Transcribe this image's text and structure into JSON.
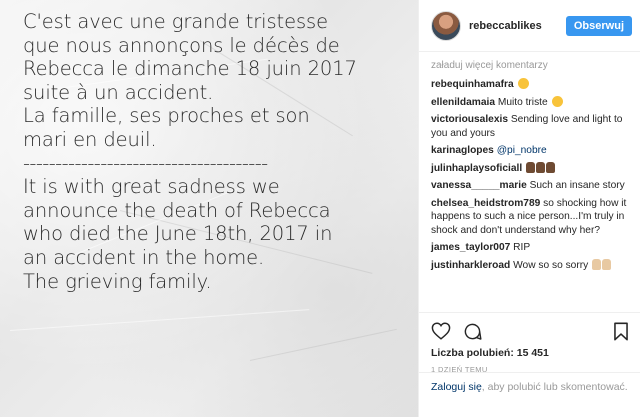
{
  "photo": {
    "lines": [
      "C'est avec une grande tristesse",
      "que nous annonçons le décès de",
      "Rebecca le dimanche 18 juin 2017",
      "suite à un accident.",
      "La famille, ses proches et son",
      "mari en deuil.",
      "--------------------------------------",
      "It is with great sadness we",
      "announce the death of Rebecca",
      "who died the June 18th, 2017 in",
      "an accident in the home.",
      "The grieving family."
    ]
  },
  "header": {
    "username": "rebeccablikes",
    "follow_label": "Obserwuj"
  },
  "comments": {
    "load_more": "załaduj więcej komentarzy",
    "items": [
      {
        "user": "rebequinhamafra",
        "text": "",
        "emoji": [
          "sad-face"
        ]
      },
      {
        "user": "ellenildamaia",
        "text": "Muito triste",
        "emoji": [
          "sad-face"
        ]
      },
      {
        "user": "victoriousalexis",
        "text": "Sending love and light to you and yours",
        "emoji": []
      },
      {
        "user": "karinaglopes",
        "text": "@pi_nobre",
        "emoji": []
      },
      {
        "user": "julinhaplaysoficiall",
        "text": "",
        "emoji": [
          "praying-hands-dark",
          "praying-hands-dark",
          "praying-hands-dark"
        ]
      },
      {
        "user": "vanessa_____marie",
        "text": "Such an insane story",
        "emoji": []
      },
      {
        "user": "chelsea_heidstrom789",
        "text": "so shocking how it happens to such a nice person...I'm truly in shock and don't understand why her?",
        "emoji": []
      },
      {
        "user": "james_taylor007",
        "text": "RIP",
        "emoji": []
      },
      {
        "user": "justinharkleroad",
        "text": "Wow so so sorry",
        "emoji": [
          "praying-hands-light",
          "praying-hands-light"
        ]
      }
    ]
  },
  "actions": {
    "icons": [
      "heart-icon",
      "comment-icon",
      "bookmark-icon"
    ],
    "likes": "Liczba polubień: 15 451",
    "time": "1 DZIEŃ TEMU"
  },
  "login": {
    "link_text": "Zaloguj się",
    "rest": ", aby polubić lub skomentować."
  },
  "colors": {
    "accent": "#3897f0",
    "link": "#003569",
    "muted": "#999999"
  }
}
